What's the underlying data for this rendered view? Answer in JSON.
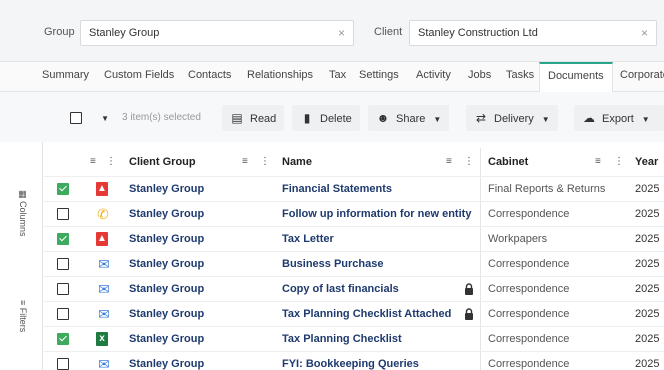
{
  "header": {
    "group_label": "Group",
    "group_value": "Stanley Group",
    "client_label": "Client",
    "client_value": "Stanley Construction Ltd",
    "clear_glyph": "×"
  },
  "tabs": [
    {
      "label": "Summary",
      "active": false
    },
    {
      "label": "Custom Fields",
      "active": false
    },
    {
      "label": "Contacts",
      "active": false
    },
    {
      "label": "Relationships",
      "active": false
    },
    {
      "label": "Tax",
      "active": false
    },
    {
      "label": "Settings",
      "active": false
    },
    {
      "label": "Activity",
      "active": false
    },
    {
      "label": "Jobs",
      "active": false
    },
    {
      "label": "Tasks",
      "active": false
    },
    {
      "label": "Documents",
      "active": true
    },
    {
      "label": "Corporate",
      "active": false
    }
  ],
  "toolbar": {
    "selected_count": "3 item(s) selected",
    "read_label": "Read",
    "delete_label": "Delete",
    "share_label": "Share",
    "delivery_label": "Delivery",
    "export_label": "Export"
  },
  "side_panel": {
    "columns_label": "Columns",
    "filters_label": "Filters"
  },
  "table": {
    "columns": [
      "Client Group",
      "Name",
      "Cabinet",
      "Year"
    ],
    "rows": [
      {
        "checked": true,
        "icon": "pdf-icon",
        "client_group": "Stanley Group",
        "name": "Financial Statements",
        "locked": false,
        "cabinet": "Final Reports & Returns",
        "year": "2025"
      },
      {
        "checked": false,
        "icon": "phone-icon",
        "client_group": "Stanley Group",
        "name": "Follow up information for new entity",
        "locked": false,
        "cabinet": "Correspondence",
        "year": "2025"
      },
      {
        "checked": true,
        "icon": "pdf-icon",
        "client_group": "Stanley Group",
        "name": "Tax Letter",
        "locked": false,
        "cabinet": "Workpapers",
        "year": "2025"
      },
      {
        "checked": false,
        "icon": "email-outline-icon",
        "client_group": "Stanley Group",
        "name": "Business Purchase",
        "locked": false,
        "cabinet": "Correspondence",
        "year": "2025"
      },
      {
        "checked": false,
        "icon": "email-icon",
        "client_group": "Stanley Group",
        "name": "Copy of last financials",
        "locked": true,
        "cabinet": "Correspondence",
        "year": "2025"
      },
      {
        "checked": false,
        "icon": "email-icon",
        "client_group": "Stanley Group",
        "name": "Tax Planning Checklist Attached",
        "locked": true,
        "cabinet": "Correspondence",
        "year": "2025"
      },
      {
        "checked": true,
        "icon": "excel-icon",
        "client_group": "Stanley Group",
        "name": "Tax Planning Checklist",
        "locked": false,
        "cabinet": "Correspondence",
        "year": "2025"
      },
      {
        "checked": false,
        "icon": "email-icon",
        "client_group": "Stanley Group",
        "name": "FYI: Bookkeeping Queries",
        "locked": false,
        "cabinet": "Correspondence",
        "year": "2025"
      }
    ]
  },
  "colors": {
    "accent": "#2aa58a",
    "checkbox_checked": "#3daa5f",
    "link_text": "#1e3a6e",
    "pdf": "#e53935",
    "excel": "#1e7a3e",
    "email": "#3b7dd8",
    "phone": "#f2b01e"
  }
}
